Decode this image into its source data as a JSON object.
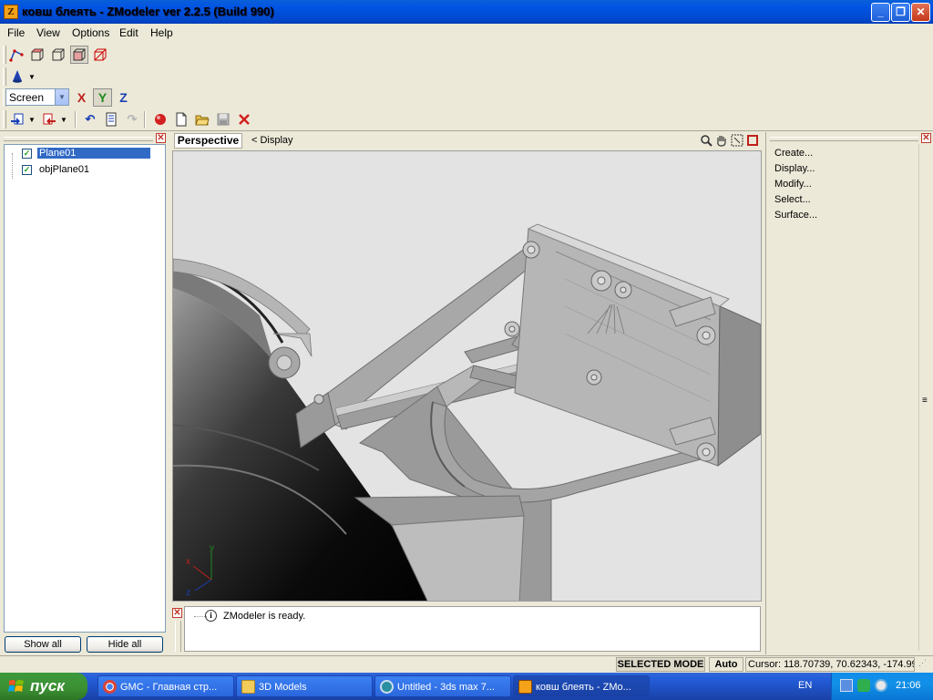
{
  "window": {
    "title": "ковш блеять - ZModeler ver 2.2.5 (Build 990)",
    "app_icon": "Z",
    "minimize": "_",
    "maximize": "❐",
    "close": "✕"
  },
  "menu": [
    "File",
    "View",
    "Options",
    "Edit",
    "Help"
  ],
  "toolbar": {
    "selection_mode_icons": [
      "vertex-select-icon",
      "polygon-select-icon",
      "object-select-icon",
      "group-select-icon",
      "selection-filter-icon"
    ],
    "axis_combo_value": "Screen",
    "axes": {
      "x": "X",
      "y": "Y",
      "z": "Z"
    },
    "file_icons": [
      "import-icon",
      "export-icon",
      "undo-icon",
      "properties-icon",
      "redo-icon",
      "record-icon",
      "new-file-icon",
      "open-folder-icon",
      "save-icon",
      "delete-icon"
    ]
  },
  "objects_panel": {
    "items": [
      {
        "label": "Plane01",
        "checked": true,
        "selected": true
      },
      {
        "label": "objPlane01",
        "checked": true,
        "selected": false
      }
    ],
    "show_all": "Show all",
    "hide_all": "Hide all",
    "close_glyph": "✕"
  },
  "viewport": {
    "tab": "Perspective",
    "display_label": "<  Display",
    "axes_gizmo": {
      "y": "y",
      "x": "x",
      "z": "z"
    },
    "background_color": "#E3E3E3"
  },
  "log": {
    "message": "ZModeler is ready.",
    "info_glyph": "i"
  },
  "command_panel": {
    "items": [
      "Create...",
      "Display...",
      "Modify...",
      "Select...",
      "Surface..."
    ]
  },
  "statusbar": {
    "mode": "SELECTED MODE",
    "auto": "Auto",
    "cursor": "Cursor: 118.70739, 70.62343, -174.99("
  },
  "taskbar": {
    "start": "пуск",
    "tasks": [
      {
        "label": "GMC - Главная стр...",
        "active": false
      },
      {
        "label": "3D Models",
        "active": false
      },
      {
        "label": "Untitled - 3ds max 7...",
        "active": false
      },
      {
        "label": "ковш блеять - ZMo...",
        "active": true
      }
    ],
    "lang": "EN",
    "time": "21:06"
  }
}
